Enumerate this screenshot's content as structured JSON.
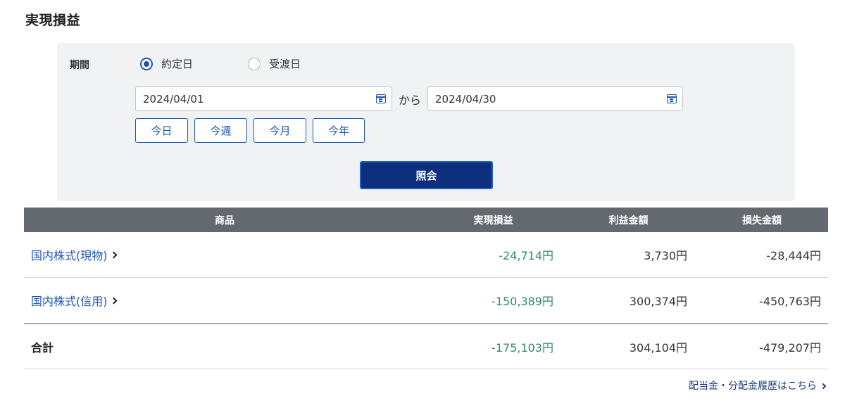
{
  "page": {
    "title": "実現損益"
  },
  "filter": {
    "period_label": "期間",
    "radio": [
      {
        "label": "約定日",
        "checked": true
      },
      {
        "label": "受渡日",
        "checked": false
      }
    ],
    "date_from": "2024/04/01",
    "date_to": "2024/04/30",
    "separator": "から",
    "quick_buttons": [
      "今日",
      "今週",
      "今月",
      "今年"
    ],
    "submit_label": "照会"
  },
  "table": {
    "headers": [
      "商品",
      "実現損益",
      "利益金額",
      "損失金額"
    ],
    "rows": [
      {
        "product": "国内株式(現物)",
        "realized": "-24,714円",
        "profit": "3,730円",
        "loss": "-28,444円"
      },
      {
        "product": "国内株式(信用)",
        "realized": "-150,389円",
        "profit": "300,374円",
        "loss": "-450,763円"
      }
    ],
    "total": {
      "label": "合計",
      "realized": "-175,103円",
      "profit": "304,104円",
      "loss": "-479,207円"
    }
  },
  "footer": {
    "link_label": "配当金・分配金履歴はこちら"
  },
  "colors": {
    "accent": "#1a56b5",
    "submit_bg": "#0e2e7e",
    "header_bg": "#646970",
    "panel_bg": "#f1f2f4",
    "realized_text": "#2d8a73"
  },
  "icons": [
    "calendar-icon",
    "chevron-right-icon"
  ]
}
